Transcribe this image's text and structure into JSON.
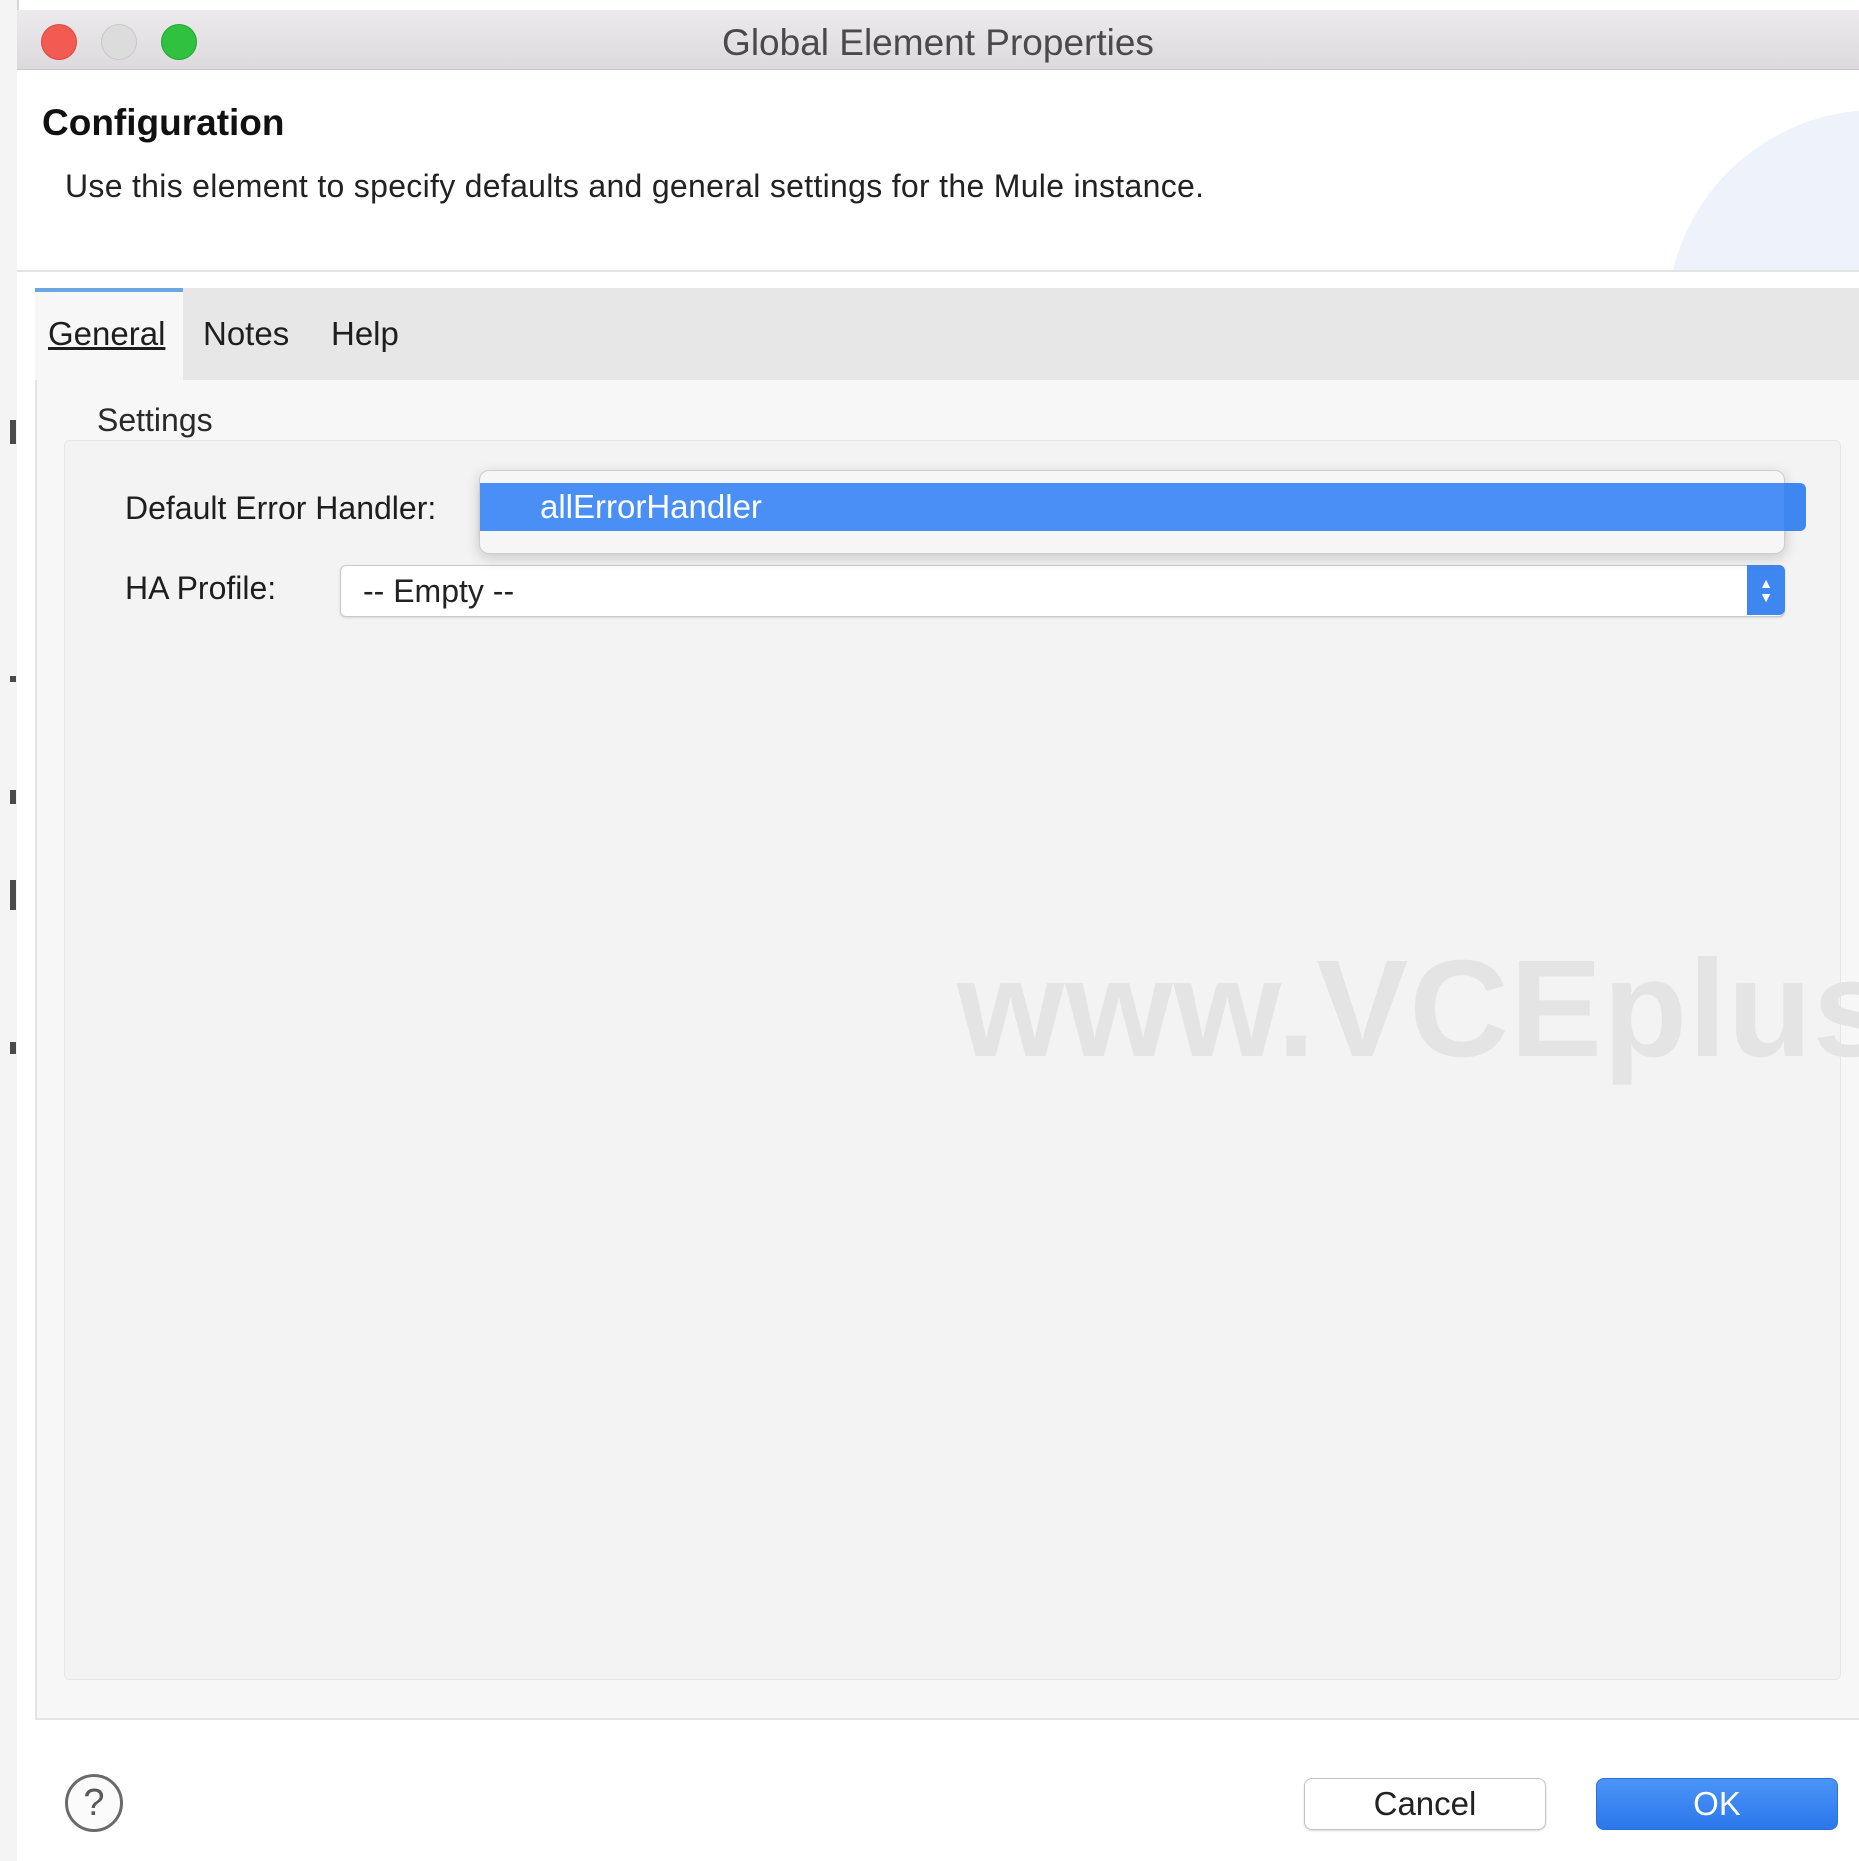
{
  "window": {
    "title": "Global Element Properties"
  },
  "header": {
    "title": "Configuration",
    "description": "Use this element to specify defaults and general settings for the Mule instance."
  },
  "tabs": [
    {
      "label": "General",
      "active": true
    },
    {
      "label": "Notes",
      "active": false
    },
    {
      "label": "Help",
      "active": false
    }
  ],
  "settings": {
    "group_label": "Settings",
    "default_error_handler": {
      "label": "Default Error Handler:",
      "open_option": "allErrorHandler"
    },
    "ha_profile": {
      "label": "HA Profile:",
      "value": "-- Empty --"
    }
  },
  "watermark": "www.VCEplus.",
  "footer": {
    "help_symbol": "?",
    "cancel_label": "Cancel",
    "ok_label": "OK"
  },
  "colors": {
    "accent": "#3e86f0",
    "selection": "#4a8ff5",
    "close": "#f25b52",
    "maximize": "#2fc13f"
  },
  "icons": [
    "close-traffic-light",
    "minimize-traffic-light",
    "maximize-traffic-light",
    "updown-chevron-icon",
    "help-icon"
  ]
}
